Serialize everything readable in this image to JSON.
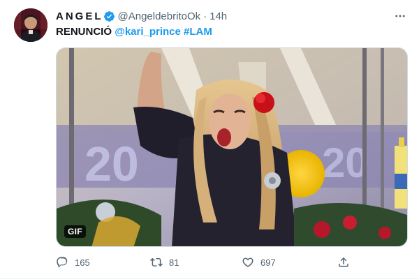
{
  "tweet": {
    "author": {
      "display_name": "ANGEL",
      "handle": "@AngeldebritoOk",
      "verified": true,
      "avatar_icon": "profile-photo"
    },
    "time": "14h",
    "separator": "·",
    "text": {
      "lead": "RENUNCIÓ",
      "mention": "@kari_prince",
      "hashtag": "#LAM"
    },
    "media": {
      "type": "gif",
      "badge": "GIF"
    },
    "actions": {
      "reply": {
        "icon": "reply-icon",
        "count": "165"
      },
      "retweet": {
        "icon": "retweet-icon",
        "count": "81"
      },
      "like": {
        "icon": "heart-icon",
        "count": "697"
      },
      "share": {
        "icon": "share-icon"
      }
    },
    "menu_icon": "more-icon"
  },
  "colors": {
    "text": "#0f1419",
    "secondary": "#536471",
    "link": "#1d9bf0",
    "verified": "#1d9bf0",
    "border": "#cfd9de"
  }
}
